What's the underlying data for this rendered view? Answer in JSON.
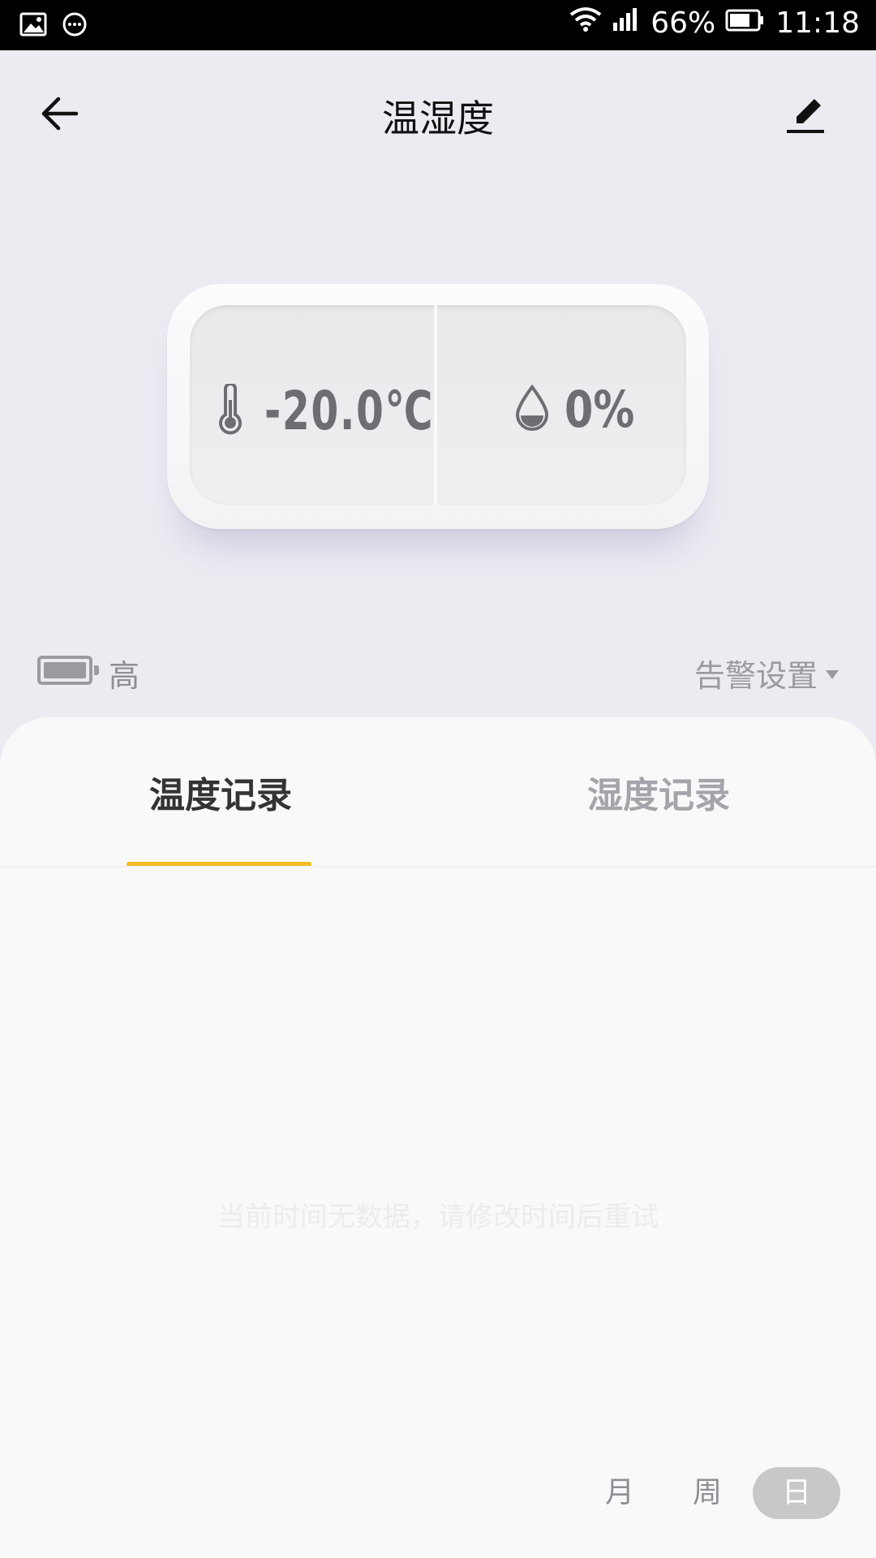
{
  "status_bar": {
    "battery": "66%",
    "time": "11:18"
  },
  "header": {
    "title": "温湿度"
  },
  "device": {
    "temperature": "-20.0℃",
    "humidity": "0%"
  },
  "battery": {
    "level_label": "高"
  },
  "alarm": {
    "label": "告警设置"
  },
  "tabs": [
    {
      "label": "温度记录",
      "active": true
    },
    {
      "label": "湿度记录",
      "active": false
    }
  ],
  "empty_message": "当前时间无数据，请修改时间后重试",
  "range": {
    "month": "月",
    "week": "周",
    "day": "日",
    "selected": "日"
  },
  "colors": {
    "accent": "#f3bb22",
    "background": "#ebebf2",
    "panel": "#f9f9fa"
  }
}
